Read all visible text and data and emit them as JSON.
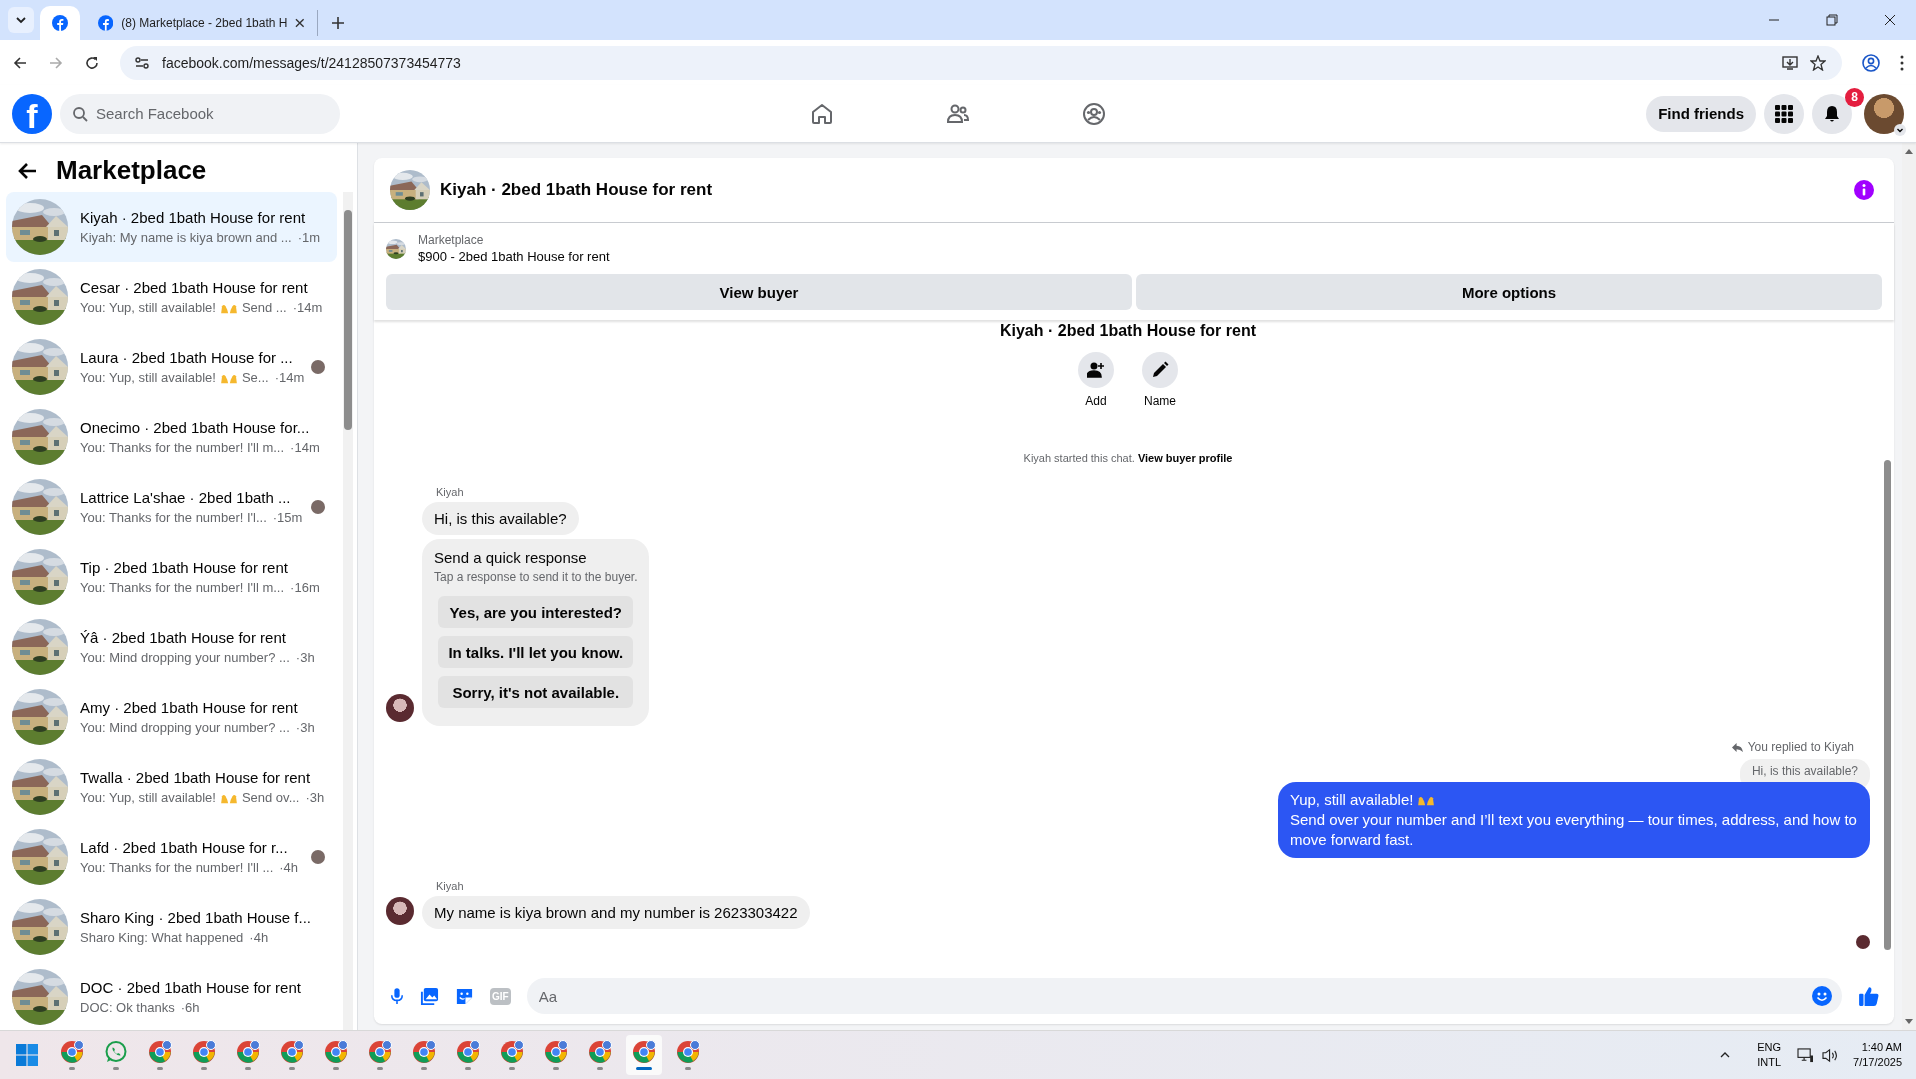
{
  "browser": {
    "tabs": [
      {
        "selected": true
      },
      {
        "title": "(8) Marketplace - 2bed 1bath H",
        "selected": false
      }
    ],
    "url": "facebook.com/messages/t/24128507373454773"
  },
  "facebook": {
    "logo_letter": "f",
    "search": {
      "placeholder": "Search Facebook"
    },
    "find_friends": "Find friends",
    "notifications": "8"
  },
  "sidebar": {
    "title": "Marketplace",
    "items": [
      {
        "title": "Kiyah · 2bed 1bath House for rent",
        "snippet": "Kiyah: My name is kiya brown and ...",
        "emoji": false,
        "time": "·1m",
        "seen": false,
        "selected": true
      },
      {
        "title": "Cesar · 2bed 1bath House for rent",
        "snippet": "You: Yup, still available!",
        "emoji": true,
        "snippet_end": "Send ...",
        "time": "·14m",
        "seen": false,
        "selected": false
      },
      {
        "title": "Laura · 2bed 1bath House for ...",
        "snippet": "You: Yup, still available!",
        "emoji": true,
        "snippet_end": "Se...",
        "time": "·14m",
        "seen": true,
        "selected": false
      },
      {
        "title": "Onecimo · 2bed 1bath House for...",
        "snippet": "You: Thanks for the number! I'll m...",
        "emoji": false,
        "time": "·14m",
        "seen": false,
        "selected": false
      },
      {
        "title": "Lattrice La'shae · 2bed 1bath ...",
        "snippet": "You: Thanks for the number! I'l...",
        "emoji": false,
        "time": "·15m",
        "seen": true,
        "selected": false
      },
      {
        "title": "Tip · 2bed 1bath House for rent",
        "snippet": "You: Thanks for the number! I'll m...",
        "emoji": false,
        "time": "·16m",
        "seen": false,
        "selected": false
      },
      {
        "title": "Ýâ · 2bed 1bath House for rent",
        "snippet": "You: Mind dropping your number? ...",
        "emoji": false,
        "time": "·3h",
        "seen": false,
        "selected": false
      },
      {
        "title": "Amy · 2bed 1bath House for rent",
        "snippet": "You: Mind dropping your number? ...",
        "emoji": false,
        "time": "·3h",
        "seen": false,
        "selected": false
      },
      {
        "title": "Twalla · 2bed 1bath House for rent",
        "snippet": "You: Yup, still available!",
        "emoji": true,
        "snippet_end": "Send ov...",
        "time": "·3h",
        "seen": false,
        "selected": false
      },
      {
        "title": "Lafd · 2bed 1bath House for r...",
        "snippet": "You: Thanks for the number! I'll ...",
        "emoji": false,
        "time": "·4h",
        "seen": true,
        "selected": false
      },
      {
        "title": "Sharo King · 2bed 1bath House f...",
        "snippet": "Sharo King: What happened",
        "emoji": false,
        "time": "·4h",
        "seen": false,
        "selected": false
      },
      {
        "title": "DOC · 2bed 1bath House for rent",
        "snippet": "DOC: Ok thanks",
        "emoji": false,
        "time": "·6h",
        "seen": false,
        "selected": false
      }
    ]
  },
  "chat": {
    "title": "Kiyah · 2bed 1bath House for rent",
    "listing": {
      "label": "Marketplace",
      "name": "$900 - 2bed 1bath House for rent"
    },
    "buttons": [
      "View buyer",
      "More options"
    ],
    "intro_title": "Kiyah · 2bed 1bath House for rent",
    "actions": [
      {
        "label": "Add",
        "kind": "add"
      },
      {
        "label": "Name",
        "kind": "name"
      }
    ],
    "started": "Kiyah started this chat.",
    "started_link": "View buyer profile",
    "first_sender": "Kiyah",
    "first_message": "Hi, is this available?",
    "quick": {
      "title": "Send a quick response",
      "subtitle": "Tap a response to send it to the buyer.",
      "options": [
        "Yes, are you interested?",
        "In talks. I'll let you know.",
        "Sorry, it's not available."
      ]
    },
    "reply_note": "You replied to Kiyah",
    "quoted": "Hi, is this available?",
    "outgoing_first": "Yup, still available!",
    "outgoing_emoji": true,
    "outgoing_rest": "Send over your number and I’ll text you everything — tour times, address, and how to move forward fast.",
    "second_sender": "Kiyah",
    "second_message": "My name is kiya brown and my number is 2623303422",
    "composer": {
      "gif": "GIF",
      "placeholder": "Aa"
    }
  },
  "taskbar": {
    "apps": [
      {
        "kind": "chrome",
        "selected": false
      },
      {
        "kind": "whatsapp",
        "selected": false
      },
      {
        "kind": "chrome",
        "selected": false
      },
      {
        "kind": "chrome",
        "selected": false
      },
      {
        "kind": "chrome",
        "selected": false
      },
      {
        "kind": "chrome",
        "selected": false
      },
      {
        "kind": "chrome",
        "selected": false
      },
      {
        "kind": "chrome",
        "selected": false
      },
      {
        "kind": "chrome",
        "selected": false
      },
      {
        "kind": "chrome",
        "selected": false
      },
      {
        "kind": "chrome",
        "selected": false
      },
      {
        "kind": "chrome",
        "selected": false
      },
      {
        "kind": "chrome",
        "selected": false
      },
      {
        "kind": "chrome",
        "selected": true
      },
      {
        "kind": "chrome",
        "selected": false
      }
    ],
    "language": "ENG",
    "layout": "INTL",
    "time": "1:40 AM",
    "date": "7/17/2025"
  }
}
